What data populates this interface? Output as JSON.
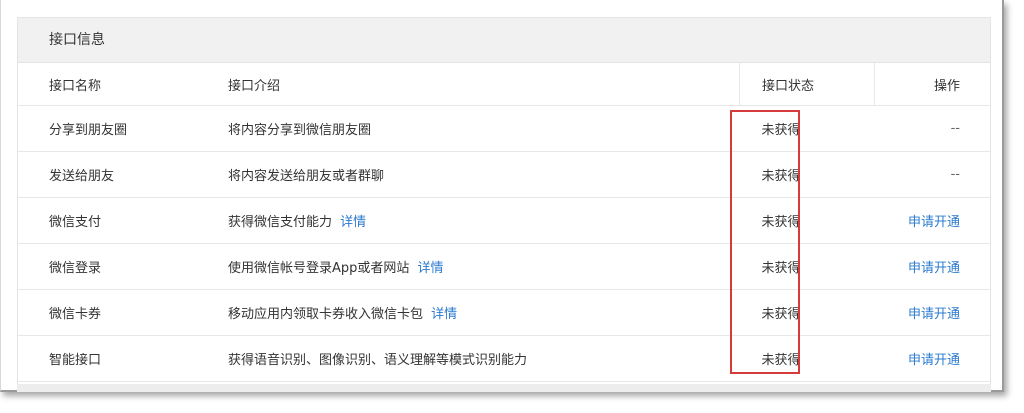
{
  "panel": {
    "title": "接口信息"
  },
  "table": {
    "headers": {
      "name": "接口名称",
      "desc": "接口介绍",
      "status": "接口状态",
      "op": "操作"
    },
    "rows": [
      {
        "name": "分享到朋友圈",
        "desc": "将内容分享到微信朋友圈",
        "detail": "",
        "status": "未获得",
        "op": "--",
        "op_is_link": false
      },
      {
        "name": "发送给朋友",
        "desc": "将内容发送给朋友或者群聊",
        "detail": "",
        "status": "未获得",
        "op": "--",
        "op_is_link": false
      },
      {
        "name": "微信支付",
        "desc": "获得微信支付能力",
        "detail": "详情",
        "status": "未获得",
        "op": "申请开通",
        "op_is_link": true
      },
      {
        "name": "微信登录",
        "desc": "使用微信帐号登录App或者网站",
        "detail": "详情",
        "status": "未获得",
        "op": "申请开通",
        "op_is_link": true
      },
      {
        "name": "微信卡券",
        "desc": "移动应用内领取卡券收入微信卡包",
        "detail": "详情",
        "status": "未获得",
        "op": "申请开通",
        "op_is_link": true
      },
      {
        "name": "智能接口",
        "desc": "获得语音识别、图像识别、语义理解等模式识别能力",
        "detail": "",
        "status": "未获得",
        "op": "申请开通",
        "op_is_link": true
      }
    ]
  },
  "colors": {
    "link": "#2b7bcf",
    "highlight_border": "#d63a3a",
    "header_bg": "#f1f1f1"
  }
}
